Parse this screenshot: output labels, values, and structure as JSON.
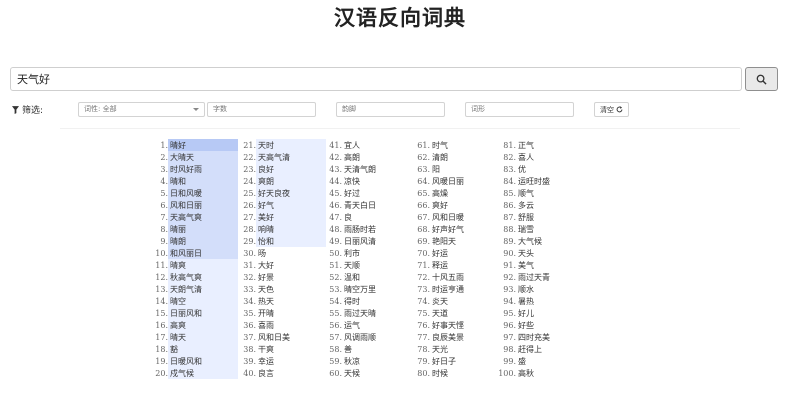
{
  "title": "汉语反向词典",
  "search": {
    "value": "天气好",
    "button_icon": "search-icon"
  },
  "filters": {
    "label": "筛选:",
    "pos_select": "词性: 全部",
    "char_count_placeholder": "字数",
    "rhyme_placeholder": "韵脚",
    "shape_placeholder": "词形",
    "clear_label": "清空"
  },
  "results": [
    {
      "n": "1.",
      "w": "晴好"
    },
    {
      "n": "2.",
      "w": "大晴天"
    },
    {
      "n": "3.",
      "w": "时风好雨"
    },
    {
      "n": "4.",
      "w": "晴和"
    },
    {
      "n": "5.",
      "w": "日和风暖"
    },
    {
      "n": "6.",
      "w": "风和日丽"
    },
    {
      "n": "7.",
      "w": "天高气爽"
    },
    {
      "n": "8.",
      "w": "晴丽"
    },
    {
      "n": "9.",
      "w": "晴朗"
    },
    {
      "n": "10.",
      "w": "和风丽日"
    },
    {
      "n": "11.",
      "w": "晴爽"
    },
    {
      "n": "12.",
      "w": "秋高气爽"
    },
    {
      "n": "13.",
      "w": "天朗气清"
    },
    {
      "n": "14.",
      "w": "晴空"
    },
    {
      "n": "15.",
      "w": "日丽风和"
    },
    {
      "n": "16.",
      "w": "高爽"
    },
    {
      "n": "17.",
      "w": "晴天"
    },
    {
      "n": "18.",
      "w": "豁"
    },
    {
      "n": "19.",
      "w": "日暖风和"
    },
    {
      "n": "20.",
      "w": "戍气候"
    },
    {
      "n": "21.",
      "w": "天时"
    },
    {
      "n": "22.",
      "w": "天高气清"
    },
    {
      "n": "23.",
      "w": "良好"
    },
    {
      "n": "24.",
      "w": "爽朗"
    },
    {
      "n": "25.",
      "w": "好天良夜"
    },
    {
      "n": "26.",
      "w": "好气"
    },
    {
      "n": "27.",
      "w": "美好"
    },
    {
      "n": "28.",
      "w": "响晴"
    },
    {
      "n": "29.",
      "w": "怡和"
    },
    {
      "n": "30.",
      "w": "旸"
    },
    {
      "n": "31.",
      "w": "大好"
    },
    {
      "n": "32.",
      "w": "好景"
    },
    {
      "n": "33.",
      "w": "天色"
    },
    {
      "n": "34.",
      "w": "热天"
    },
    {
      "n": "35.",
      "w": "开晴"
    },
    {
      "n": "36.",
      "w": "喜雨"
    },
    {
      "n": "37.",
      "w": "风和日美"
    },
    {
      "n": "38.",
      "w": "干爽"
    },
    {
      "n": "39.",
      "w": "幸运"
    },
    {
      "n": "40.",
      "w": "良言"
    },
    {
      "n": "41.",
      "w": "宜人"
    },
    {
      "n": "42.",
      "w": "高朗"
    },
    {
      "n": "43.",
      "w": "天清气朗"
    },
    {
      "n": "44.",
      "w": "凉快"
    },
    {
      "n": "45.",
      "w": "好过"
    },
    {
      "n": "46.",
      "w": "青天白日"
    },
    {
      "n": "47.",
      "w": "良"
    },
    {
      "n": "48.",
      "w": "雨肠时若"
    },
    {
      "n": "49.",
      "w": "日丽风清"
    },
    {
      "n": "50.",
      "w": "利市"
    },
    {
      "n": "51.",
      "w": "天顺"
    },
    {
      "n": "52.",
      "w": "温和"
    },
    {
      "n": "53.",
      "w": "晴空万里"
    },
    {
      "n": "54.",
      "w": "得时"
    },
    {
      "n": "55.",
      "w": "雨过天晴"
    },
    {
      "n": "56.",
      "w": "运气"
    },
    {
      "n": "57.",
      "w": "风调雨顺"
    },
    {
      "n": "58.",
      "w": "善"
    },
    {
      "n": "59.",
      "w": "秋凉"
    },
    {
      "n": "60.",
      "w": "天候"
    },
    {
      "n": "61.",
      "w": "时气"
    },
    {
      "n": "62.",
      "w": "清朗"
    },
    {
      "n": "63.",
      "w": "阳"
    },
    {
      "n": "64.",
      "w": "风暖日丽"
    },
    {
      "n": "65.",
      "w": "高燥"
    },
    {
      "n": "66.",
      "w": "爽好"
    },
    {
      "n": "67.",
      "w": "风和日暖"
    },
    {
      "n": "68.",
      "w": "好声好气"
    },
    {
      "n": "69.",
      "w": "艳阳天"
    },
    {
      "n": "70.",
      "w": "好运"
    },
    {
      "n": "71.",
      "w": "释运"
    },
    {
      "n": "72.",
      "w": "十风五雨"
    },
    {
      "n": "73.",
      "w": "时运亨通"
    },
    {
      "n": "74.",
      "w": "炎天"
    },
    {
      "n": "75.",
      "w": "天道"
    },
    {
      "n": "76.",
      "w": "好事天悭"
    },
    {
      "n": "77.",
      "w": "良辰美景"
    },
    {
      "n": "78.",
      "w": "天光"
    },
    {
      "n": "79.",
      "w": "好日子"
    },
    {
      "n": "80.",
      "w": "时候"
    },
    {
      "n": "81.",
      "w": "正气"
    },
    {
      "n": "82.",
      "w": "喜人"
    },
    {
      "n": "83.",
      "w": "优"
    },
    {
      "n": "84.",
      "w": "运旺时盛"
    },
    {
      "n": "85.",
      "w": "顺气"
    },
    {
      "n": "86.",
      "w": "多云"
    },
    {
      "n": "87.",
      "w": "舒服"
    },
    {
      "n": "88.",
      "w": "瑞雪"
    },
    {
      "n": "89.",
      "w": "大气候"
    },
    {
      "n": "90.",
      "w": "天头"
    },
    {
      "n": "91.",
      "w": "美气"
    },
    {
      "n": "92.",
      "w": "雨过天青"
    },
    {
      "n": "93.",
      "w": "顺水"
    },
    {
      "n": "94.",
      "w": "暑热"
    },
    {
      "n": "95.",
      "w": "好儿"
    },
    {
      "n": "96.",
      "w": "好些"
    },
    {
      "n": "97.",
      "w": "四时充美"
    },
    {
      "n": "98.",
      "w": "赶得上"
    },
    {
      "n": "99.",
      "w": "盛"
    },
    {
      "n": "100.",
      "w": "高秋"
    }
  ],
  "colors": {
    "highlight_strong": "#b7c9f5",
    "highlight_mid": "#d3defa",
    "highlight_light": "#e9efff"
  }
}
